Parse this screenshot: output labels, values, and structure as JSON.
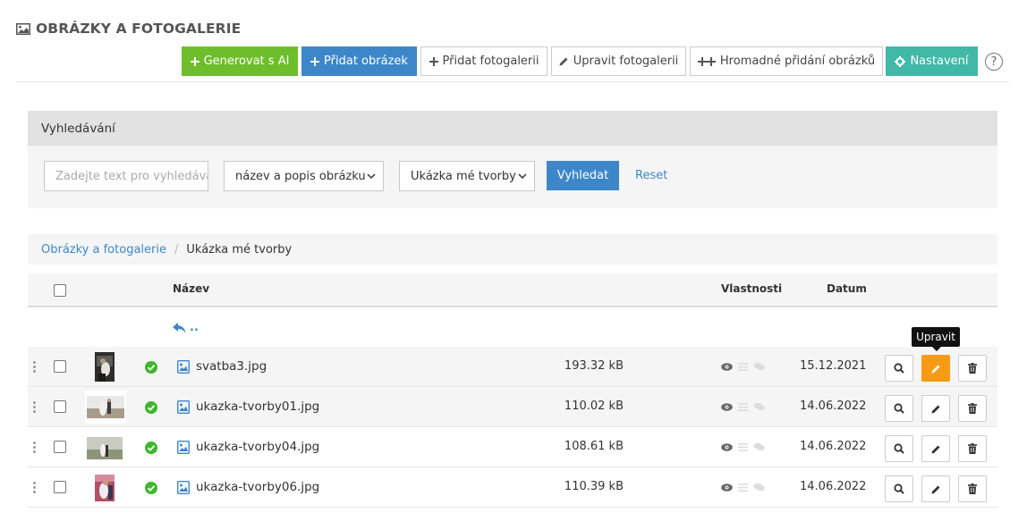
{
  "page": {
    "title": "OBRÁZKY A FOTOGALERIE",
    "help": "?"
  },
  "toolbar": {
    "buttons": [
      {
        "label": "Generovat s AI",
        "icon": "plus-icon"
      },
      {
        "label": "Přidat obrázek",
        "icon": "plus-icon"
      },
      {
        "label": "Přidat fotogalerii",
        "icon": "plus-icon"
      },
      {
        "label": "Upravit fotogalerii",
        "icon": "pencil-icon"
      },
      {
        "label": "Hromadné přidání obrázků",
        "icon": "double-plus-icon"
      },
      {
        "label": "Nastavení",
        "icon": "gear-icon"
      }
    ]
  },
  "search": {
    "heading": "Vyhledávání",
    "placeholder": "Zadejte text pro vyhledávání",
    "field_select": "název a popis obrázku",
    "gallery_select": "Ukázka mé tvorby",
    "submit": "Vyhledat",
    "reset": "Reset"
  },
  "breadcrumb": {
    "root": "Obrázky a fotogalerie",
    "separator": "/",
    "current": "Ukázka mé tvorby"
  },
  "table": {
    "headers": {
      "name": "Název",
      "properties": "Vlastnosti",
      "date": "Datum"
    },
    "up_label": "..",
    "rows": [
      {
        "name": "svatba3.jpg",
        "size": "193.32 kB",
        "date": "15.12.2021"
      },
      {
        "name": "ukazka-tvorby01.jpg",
        "size": "110.02 kB",
        "date": "14.06.2022"
      },
      {
        "name": "ukazka-tvorby04.jpg",
        "size": "108.61 kB",
        "date": "14.06.2022"
      },
      {
        "name": "ukazka-tvorby06.jpg",
        "size": "110.39 kB",
        "date": "14.06.2022"
      }
    ]
  },
  "tooltip": {
    "edit": "Upravit"
  },
  "colors": {
    "green": "#6ebd2a",
    "blue": "#3d87c9",
    "teal": "#41b8a8",
    "orange_active": "#f89a14",
    "status_ok": "#3fb62e"
  }
}
